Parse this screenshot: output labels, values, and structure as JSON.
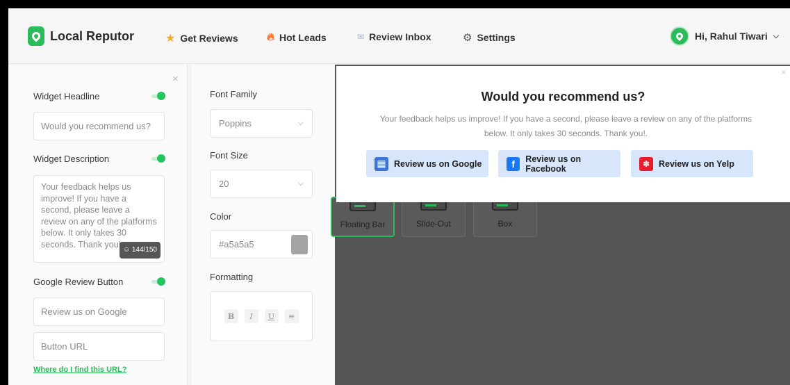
{
  "header": {
    "brand": "Local Reputor",
    "nav": [
      {
        "label": "Get Reviews",
        "icon": "star-icon"
      },
      {
        "label": "Hot Leads",
        "icon": "fire-icon"
      },
      {
        "label": "Review Inbox",
        "icon": "mail-icon"
      },
      {
        "label": "Settings",
        "icon": "gear-icon"
      }
    ],
    "user_greeting": "Hi, Rahul Tiwari"
  },
  "settings": {
    "headline_label": "Widget Headline",
    "headline_value": "Would you recommend us?",
    "description_label": "Widget Description",
    "description_value": "Your feedback helps us improve! If you have a second, please leave a review on any of the platforms below. It only takes 30 seconds. Thank you!.",
    "char_count": "144/150",
    "google_button_label": "Google Review Button",
    "google_button_placeholder": "Review us on Google",
    "button_url_placeholder": "Button URL",
    "find_url_link": "Where do I find this URL?"
  },
  "typography": {
    "font_family_label": "Font Family",
    "font_family_value": "Poppins",
    "font_size_label": "Font Size",
    "font_size_value": "20",
    "color_label": "Color",
    "color_value": "#a5a5a5",
    "formatting_label": "Formatting",
    "formatting_buttons": [
      "B",
      "I",
      "U",
      "≡"
    ]
  },
  "layouts": [
    "Floating Bar",
    "Slide-Out",
    "Box"
  ],
  "widget": {
    "title": "Would you recommend us?",
    "description": "Your feedback helps us improve! If you have a second, please leave a review on any of the platforms below. It only takes 30 seconds. Thank you!.",
    "buttons": [
      {
        "label": "Review us on Google",
        "icon": "google-business-icon"
      },
      {
        "label": "Review us on Facebook",
        "icon": "facebook-icon"
      },
      {
        "label": "Review us on Yelp",
        "icon": "yelp-icon"
      }
    ]
  },
  "colors": {
    "accent": "#2bbb5a",
    "button_bg": "#d8e6fb",
    "preview_bg": "#555555"
  }
}
